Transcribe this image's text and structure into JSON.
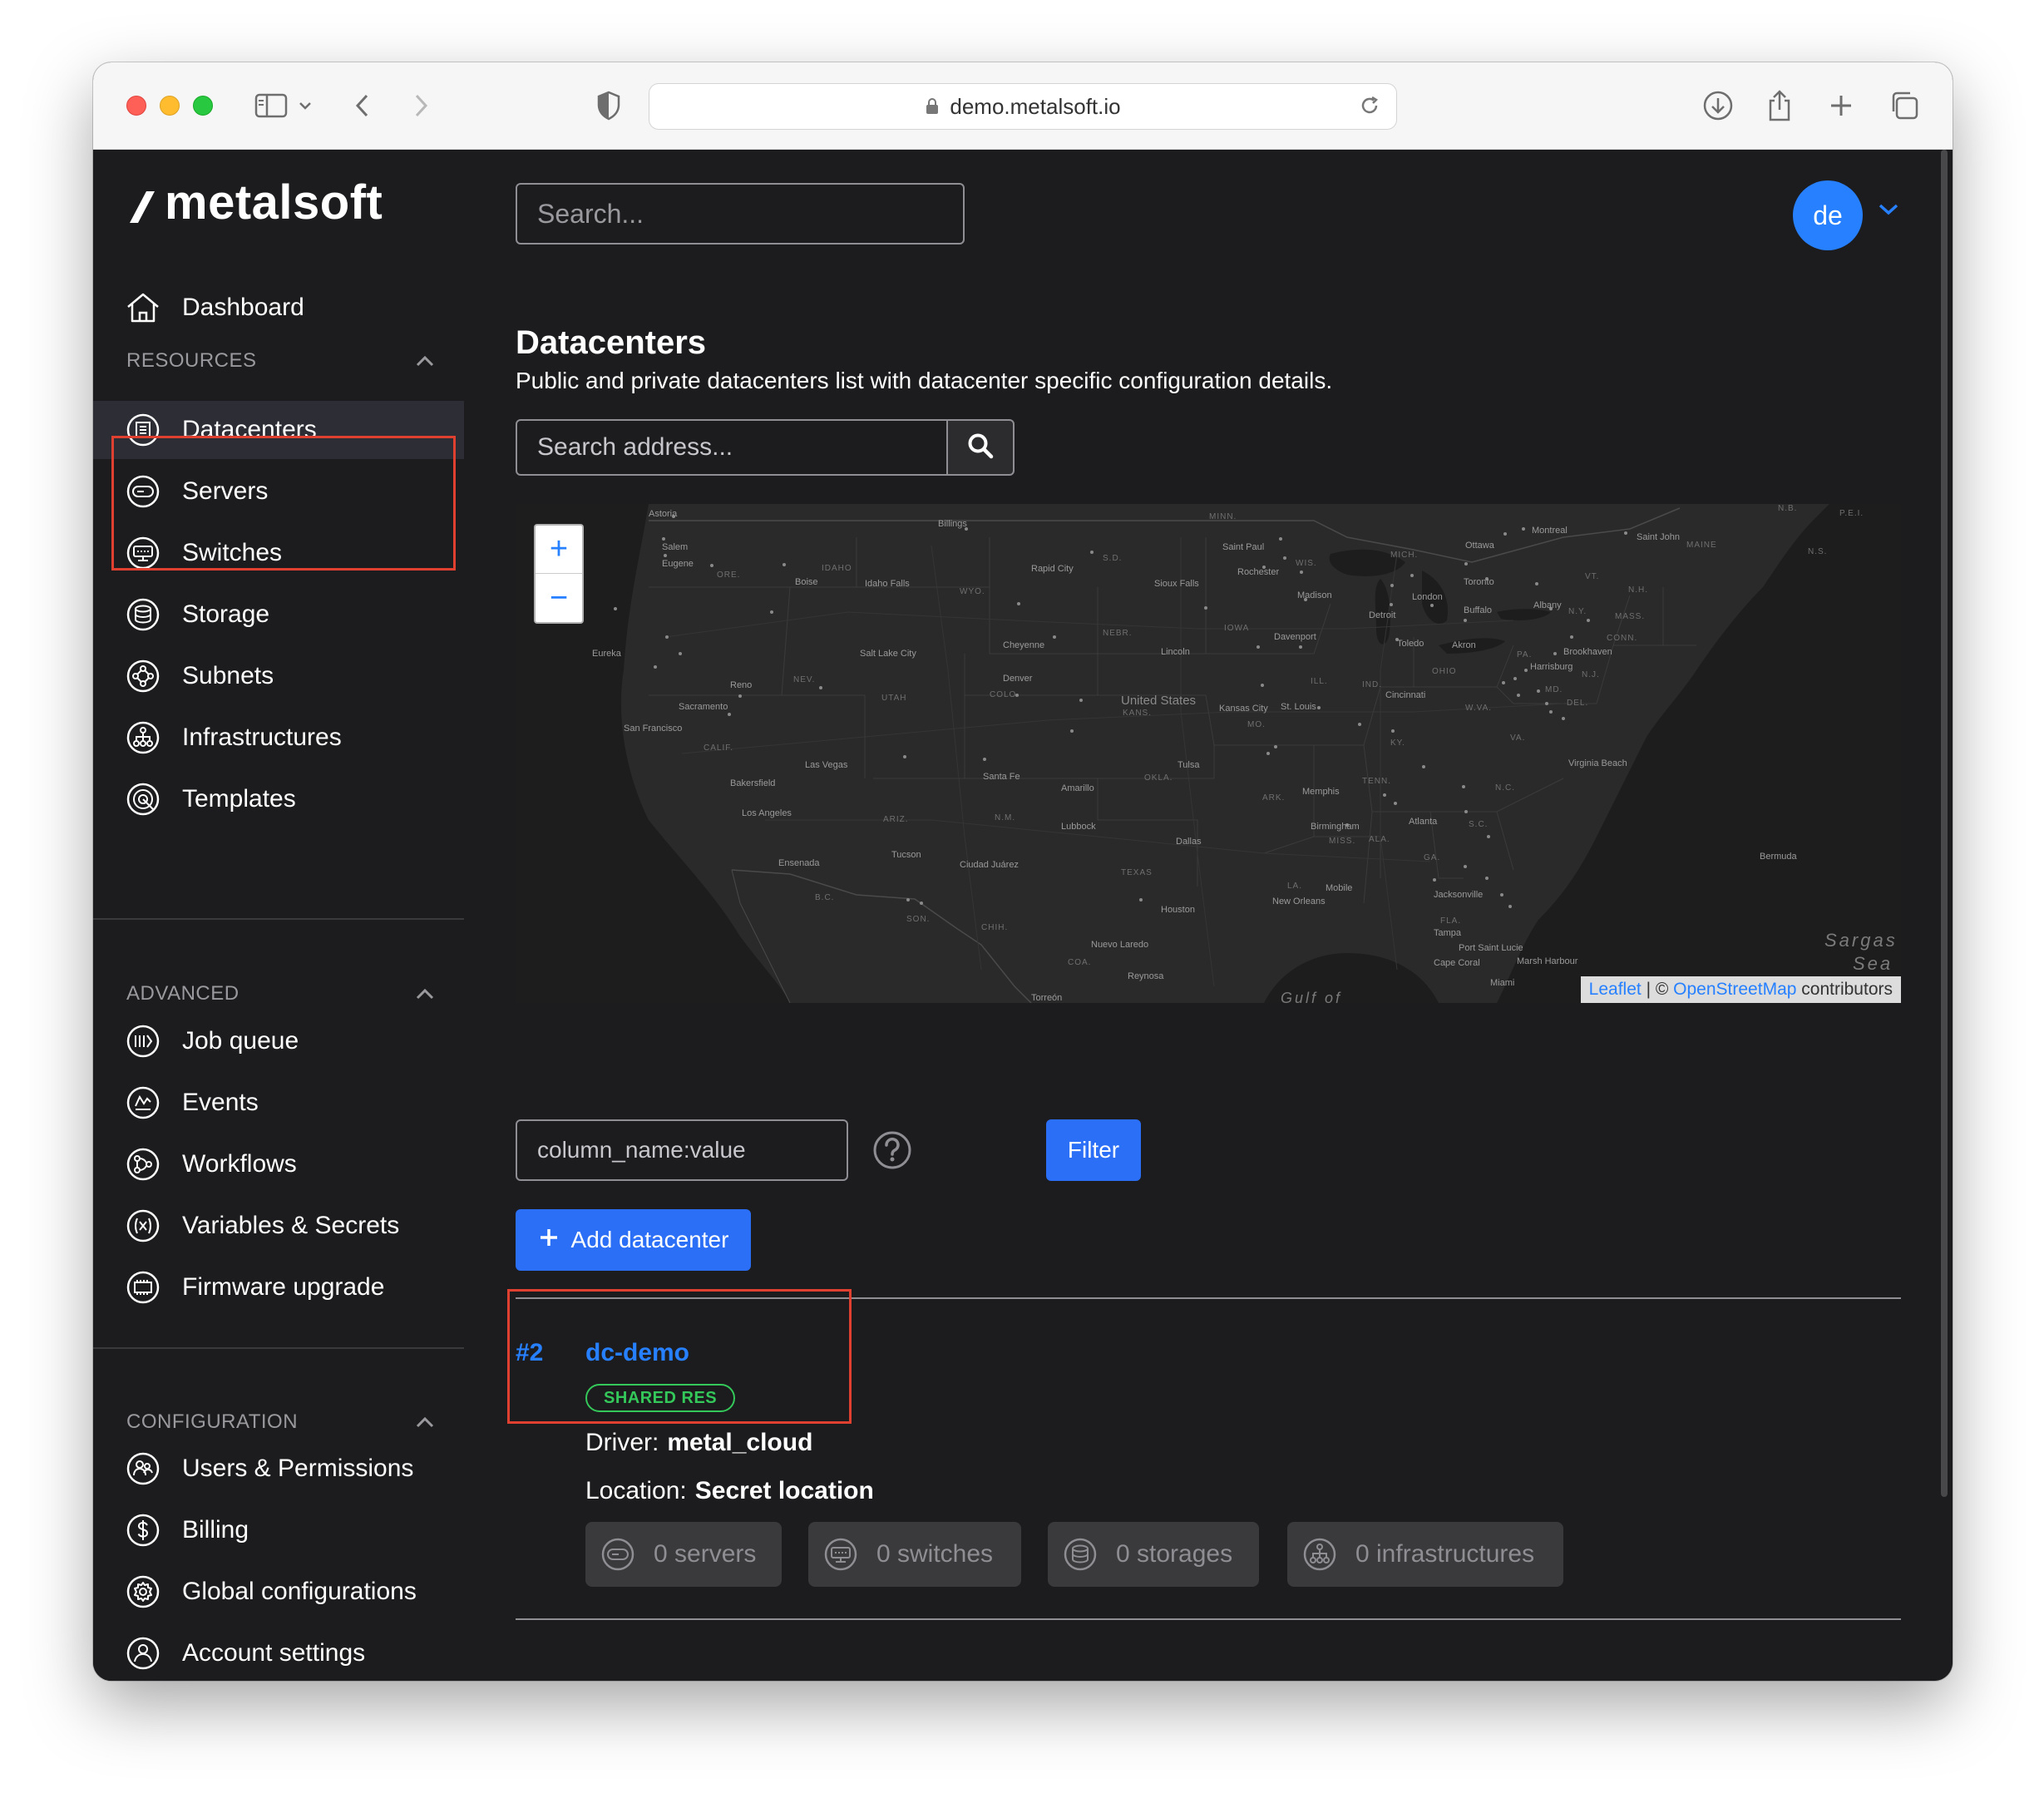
{
  "browser": {
    "url": "demo.metalsoft.io"
  },
  "app": {
    "logo_text": "metalsoft",
    "search_placeholder": "Search...",
    "user_initials": "de"
  },
  "sidebar": {
    "dashboard": "Dashboard",
    "sections": [
      {
        "title": "RESOURCES",
        "items": [
          "Datacenters",
          "Servers",
          "Switches",
          "Storage",
          "Subnets",
          "Infrastructures",
          "Templates"
        ]
      },
      {
        "title": "ADVANCED",
        "items": [
          "Job queue",
          "Events",
          "Workflows",
          "Variables & Secrets",
          "Firmware upgrade"
        ]
      },
      {
        "title": "CONFIGURATION",
        "items": [
          "Users & Permissions",
          "Billing",
          "Global configurations",
          "Account settings"
        ]
      }
    ],
    "active_item": "Datacenters"
  },
  "page": {
    "title": "Datacenters",
    "subtitle": "Public and private datacenters list with datacenter specific configuration details.",
    "address_placeholder": "Search address...",
    "filter_placeholder": "column_name:value",
    "filter_button": "Filter",
    "add_button": "Add datacenter"
  },
  "map": {
    "country_label": "United States",
    "sea_label_1": "Sargas",
    "sea_label_2": "Sea",
    "gulf_label": "Gulf of",
    "bermuda": "Bermuda",
    "zoom_in": "+",
    "zoom_out": "−",
    "attribution_leaflet": "Leaflet",
    "attribution_sep": " | © ",
    "attribution_osm": "OpenStreetMap",
    "attribution_tail": " contributors",
    "cities": [
      {
        "name": "Astoria"
      },
      {
        "name": "Salem"
      },
      {
        "name": "Eugene"
      },
      {
        "name": "Boise"
      },
      {
        "name": "Idaho Falls"
      },
      {
        "name": "Billings"
      },
      {
        "name": "Rapid City"
      },
      {
        "name": "Saint Paul"
      },
      {
        "name": "Rochester"
      },
      {
        "name": "Sioux Falls"
      },
      {
        "name": "Madison"
      },
      {
        "name": "Ottawa"
      },
      {
        "name": "Montreal"
      },
      {
        "name": "Saint John"
      },
      {
        "name": "Toronto"
      },
      {
        "name": "London"
      },
      {
        "name": "Detroit"
      },
      {
        "name": "Buffalo"
      },
      {
        "name": "Albany"
      },
      {
        "name": "Eureka"
      },
      {
        "name": "Salt Lake City"
      },
      {
        "name": "Cheyenne"
      },
      {
        "name": "Lincoln"
      },
      {
        "name": "Davenport"
      },
      {
        "name": "Toledo"
      },
      {
        "name": "Akron"
      },
      {
        "name": "Harrisburg"
      },
      {
        "name": "Brookhaven"
      },
      {
        "name": "Reno"
      },
      {
        "name": "Denver"
      },
      {
        "name": "Sacramento"
      },
      {
        "name": "San Francisco"
      },
      {
        "name": "Kansas City"
      },
      {
        "name": "St. Louis"
      },
      {
        "name": "Cincinnati"
      },
      {
        "name": "Las Vegas"
      },
      {
        "name": "Bakersfield"
      },
      {
        "name": "Santa Fe"
      },
      {
        "name": "Amarillo"
      },
      {
        "name": "Tulsa"
      },
      {
        "name": "Memphis"
      },
      {
        "name": "Virginia Beach"
      },
      {
        "name": "Los Angeles"
      },
      {
        "name": "Lubbock"
      },
      {
        "name": "Birmingham"
      },
      {
        "name": "Atlanta"
      },
      {
        "name": "Ensenada"
      },
      {
        "name": "Tucson"
      },
      {
        "name": "Ciudad Juárez"
      },
      {
        "name": "Dallas"
      },
      {
        "name": "Mobile"
      },
      {
        "name": "Houston"
      },
      {
        "name": "New Orleans"
      },
      {
        "name": "Jacksonville"
      },
      {
        "name": "Tampa"
      },
      {
        "name": "Port Saint Lucie"
      },
      {
        "name": "Cape Coral"
      },
      {
        "name": "Miami"
      },
      {
        "name": "Nuevo Laredo"
      },
      {
        "name": "Reynosa"
      },
      {
        "name": "Torreón"
      },
      {
        "name": "Marsh Harbour"
      }
    ],
    "states": [
      "ORE.",
      "IDAHO",
      "WYO.",
      "S.D.",
      "MINN.",
      "WIS.",
      "MICH.",
      "N.Y.",
      "VT.",
      "N.H.",
      "MASS.",
      "CONN.",
      "PA.",
      "N.J.",
      "DEL.",
      "MD.",
      "W.VA.",
      "VA.",
      "N.C.",
      "S.C.",
      "GA.",
      "FLA.",
      "ALA.",
      "MISS.",
      "LA.",
      "TEXAS",
      "OKLA.",
      "KANS.",
      "NEBR.",
      "IOWA",
      "ILL.",
      "IND.",
      "OHIO",
      "KY.",
      "TENN.",
      "ARK.",
      "MO.",
      "COLO.",
      "UTAH",
      "NEV.",
      "CALIF.",
      "ARIZ.",
      "N.M.",
      "MAINE",
      "N.S.",
      "P.E.I.",
      "N.B.",
      "B.C.",
      "SON.",
      "CHIH.",
      "COA."
    ]
  },
  "datacenters": [
    {
      "id": "#2",
      "name": "dc-demo",
      "badge": "SHARED RES",
      "driver_label": "Driver:",
      "driver": "metal_cloud",
      "location_label": "Location:",
      "location": "Secret location",
      "stats": {
        "servers": "0 servers",
        "switches": "0 switches",
        "storages": "0 storages",
        "infrastructures": "0 infrastructures"
      }
    }
  ],
  "colors": {
    "accent": "#2680ff",
    "primary_button": "#2b6ff6",
    "badge_green": "#34c759",
    "highlight_red": "#e0402f",
    "background": "#1c1c1e"
  }
}
